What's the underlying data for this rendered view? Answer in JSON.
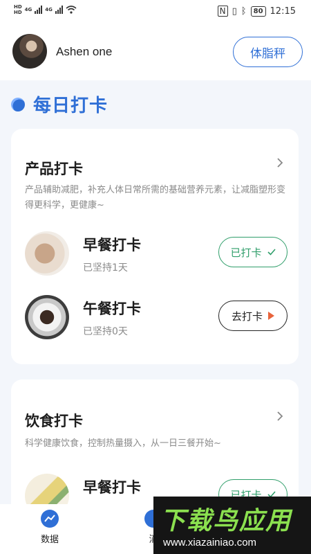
{
  "status_bar": {
    "left_labels": [
      "HD",
      "HD",
      "4G",
      "4G"
    ],
    "battery": "80",
    "time": "12:15"
  },
  "header": {
    "username": "Ashen one",
    "scale_button": "体脂秤"
  },
  "section": {
    "title": "每日打卡"
  },
  "cards": [
    {
      "title": "产品打卡",
      "description": "产品辅助减肥，补充人体日常所需的基础营养元素，让减脂塑形变得更科学，更健康~",
      "items": [
        {
          "meal": "早餐打卡",
          "streak": "已坚持1天",
          "button": "已打卡",
          "state": "done"
        },
        {
          "meal": "午餐打卡",
          "streak": "已坚持0天",
          "button": "去打卡",
          "state": "todo"
        }
      ]
    },
    {
      "title": "饮食打卡",
      "description": "科学健康饮食，控制热量摄入，从一日三餐开始~",
      "items": [
        {
          "meal": "早餐打卡",
          "button": "已打卡",
          "state": "done"
        }
      ]
    }
  ],
  "bottom_nav": [
    {
      "label": "数据",
      "icon": "chart-icon"
    },
    {
      "label": "消",
      "icon": "message-icon"
    }
  ],
  "watermark": {
    "title": "下载鸟应用",
    "url": "www.xiazainiao.com"
  },
  "colors": {
    "accent": "#2f6fd6",
    "done": "#2f9e6a",
    "go_arrow": "#e8643c"
  }
}
